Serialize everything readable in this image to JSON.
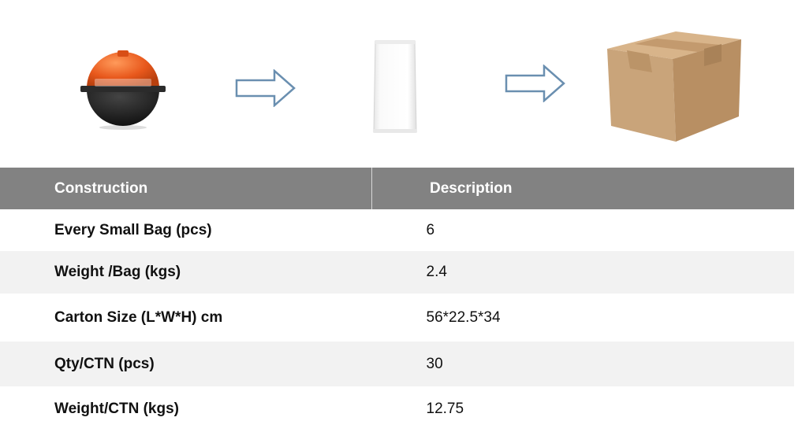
{
  "visual": {
    "product_icon": "orange-black-marker-ball",
    "bag_icon": "white-plastic-bag",
    "carton_icon": "cardboard-carton-box",
    "arrow_icon": "outline-right-arrow",
    "colors": {
      "ball_orange": "#e8581c",
      "ball_black": "#1a1a1a",
      "arrow_stroke": "#6a8fb0",
      "carton": "#c9a47a",
      "header_bg": "#828282",
      "stripe_bg": "#f2f2f2"
    }
  },
  "table": {
    "headers": [
      "Construction",
      "Description"
    ],
    "rows": [
      {
        "label": "Every Small Bag (pcs)",
        "value": "6"
      },
      {
        "label": "Weight /Bag (kgs)",
        "value": "2.4"
      },
      {
        "label": "Carton Size (L*W*H) cm",
        "value": "56*22.5*34"
      },
      {
        "label": "Qty/CTN (pcs)",
        "value": "30"
      },
      {
        "label": "Weight/CTN (kgs)",
        "value": "12.75"
      }
    ]
  }
}
